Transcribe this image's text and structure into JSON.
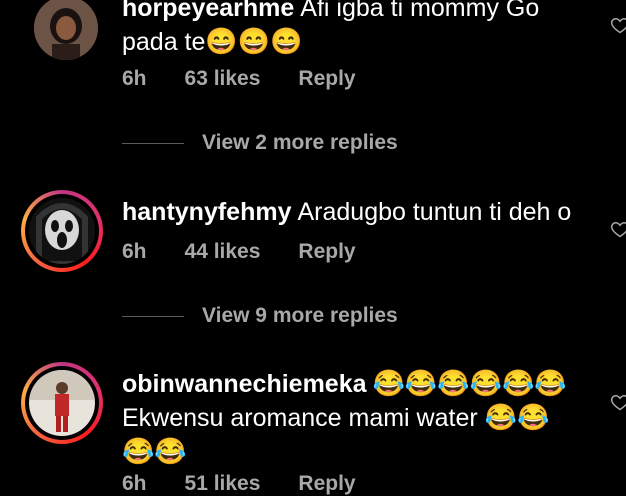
{
  "comments": [
    {
      "username": "horpeyearhme",
      "text_1": "Afi igba ti mommy Go",
      "text_2": "pada te",
      "emojis": "😄😄😄",
      "time": "6h",
      "likes": "63 likes",
      "reply": "Reply",
      "view_replies": "View 2 more replies"
    },
    {
      "username": "hantynyfehmy",
      "text_1": "Aradugbo tuntun ti deh o",
      "time": "6h",
      "likes": "44 likes",
      "reply": "Reply",
      "view_replies": "View 9 more replies"
    },
    {
      "username": "obinwannechiemeka",
      "emojis_1": "😂😂😂😂😂😂",
      "text_1": "Ekwensu aromance mami water",
      "emojis_2": "😂😂",
      "emojis_3": "😂😂",
      "time": "6h",
      "likes": "51 likes",
      "reply": "Reply"
    }
  ],
  "colors": {
    "background": "#000000",
    "text": "#ffffff",
    "meta": "#a8a8a8",
    "story_ring": [
      "#c13584",
      "#fcaf45"
    ]
  }
}
